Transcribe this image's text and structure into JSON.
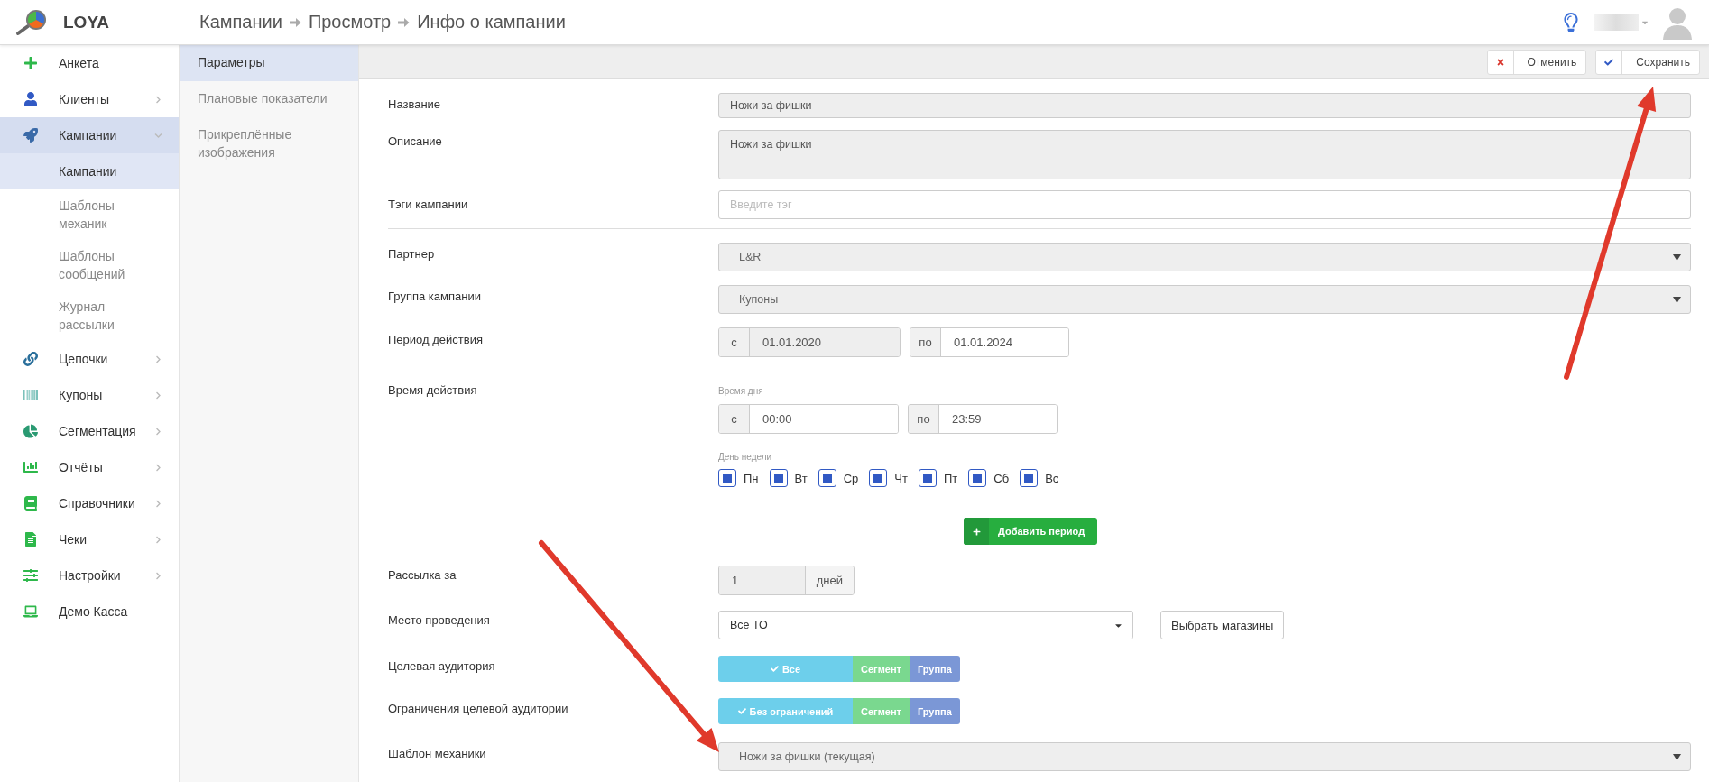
{
  "app": {
    "name": "LOYA"
  },
  "breadcrumbs": [
    "Кампании",
    "Просмотр",
    "Инфо о кампании"
  ],
  "sidebar": {
    "items": [
      {
        "label": "Анкета",
        "selected": false
      },
      {
        "label": "Клиенты",
        "selected": false,
        "expanded": false
      },
      {
        "label": "Кампании",
        "selected": true,
        "expanded": true,
        "children": [
          {
            "label": "Кампании",
            "selected": true
          },
          {
            "label": "Шаблоны механик",
            "selected": false
          },
          {
            "label": "Шаблоны сообщений",
            "selected": false
          },
          {
            "label": "Журнал рассылки",
            "selected": false
          }
        ]
      },
      {
        "label": "Цепочки",
        "selected": false,
        "expanded": false
      },
      {
        "label": "Купоны",
        "selected": false,
        "expanded": false
      },
      {
        "label": "Сегментация",
        "selected": false,
        "expanded": false
      },
      {
        "label": "Отчёты",
        "selected": false,
        "expanded": false
      },
      {
        "label": "Справочники",
        "selected": false,
        "expanded": false
      },
      {
        "label": "Чеки",
        "selected": false,
        "expanded": false
      },
      {
        "label": "Настройки",
        "selected": false,
        "expanded": false
      },
      {
        "label": "Демо Касса",
        "selected": false
      }
    ]
  },
  "subnav": [
    {
      "label": "Параметры",
      "selected": true
    },
    {
      "label": "Плановые показатели",
      "selected": false
    },
    {
      "label": "Прикреплённые изображения",
      "selected": false
    }
  ],
  "toolbar": {
    "buttons": [
      {
        "kind": "cancel",
        "label": "Отменить"
      },
      {
        "kind": "save",
        "label": "Сохранить"
      }
    ]
  },
  "form": {
    "rows": [
      {
        "kind": "text",
        "label": "Название",
        "value": "Ножи за фишки",
        "disabled": true
      },
      {
        "kind": "textarea",
        "label": "Описание",
        "value": "Ножи за фишки",
        "disabled": true
      },
      {
        "kind": "tags",
        "label": "Тэги кампании",
        "placeholder": "Введите тэг"
      },
      {
        "kind": "divider"
      },
      {
        "kind": "select",
        "label": "Партнер",
        "value": "L&R",
        "disabled": true
      },
      {
        "kind": "select",
        "label": "Группа кампании",
        "value": "Купоны",
        "disabled": true
      },
      {
        "kind": "range",
        "label": "Период действия",
        "parts": [
          {
            "prefix": "с",
            "value": "01.01.2020",
            "disabled": true
          },
          {
            "prefix": "по",
            "value": "01.01.2024",
            "disabled": false
          }
        ]
      },
      {
        "kind": "schedule",
        "label": "Время действия",
        "time_caption": "Время дня",
        "parts": [
          {
            "prefix": "с",
            "value": "00:00",
            "disabled": false
          },
          {
            "prefix": "по",
            "value": "23:59",
            "disabled": false
          }
        ],
        "day_caption": "День недели",
        "days": [
          {
            "label": "Пн",
            "checked": true
          },
          {
            "label": "Вт",
            "checked": true
          },
          {
            "label": "Ср",
            "checked": true
          },
          {
            "label": "Чт",
            "checked": true
          },
          {
            "label": "Пт",
            "checked": true
          },
          {
            "label": "Сб",
            "checked": true
          },
          {
            "label": "Вс",
            "checked": true
          }
        ],
        "add_button": "Добавить период"
      },
      {
        "kind": "unit",
        "label": "Рассылка за",
        "value": "1",
        "unit": "дней",
        "disabled": true
      },
      {
        "kind": "picker",
        "label": "Место проведения",
        "value": "Все ТО",
        "button": "Выбрать магазины"
      },
      {
        "kind": "segmented",
        "label": "Целевая аудитория",
        "options": [
          {
            "label": "Все",
            "selected": true,
            "color": "#6dcfeb"
          },
          {
            "label": "Сегмент",
            "selected": false,
            "color": "#7ad88f"
          },
          {
            "label": "Группа",
            "selected": false,
            "color": "#7b97d6"
          }
        ]
      },
      {
        "kind": "segmented",
        "label": "Ограничения целевой аудитории",
        "options": [
          {
            "label": "Без ограничений",
            "selected": true,
            "color": "#6dcfeb"
          },
          {
            "label": "Сегмент",
            "selected": false,
            "color": "#7ad88f"
          },
          {
            "label": "Группа",
            "selected": false,
            "color": "#7b97d6"
          }
        ]
      },
      {
        "kind": "select",
        "label": "Шаблон механики",
        "value": "Ножи за фишки (текущая)",
        "disabled": true
      }
    ]
  }
}
